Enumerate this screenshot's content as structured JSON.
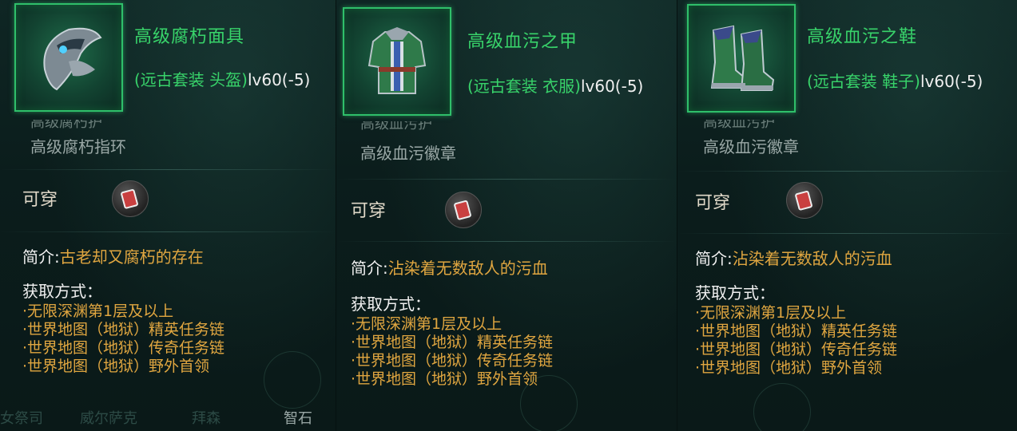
{
  "panels": [
    {
      "item_name": "高级腐朽面具",
      "set_text": "(远古套装 头盔)",
      "level_text": "lv60(-5)",
      "faded_text": "高级腐朽护",
      "set_piece": "高级腐朽指环",
      "wearable": "可穿",
      "desc_label": "简介:",
      "desc_value": "古老却又腐朽的存在",
      "acq_title": "获取方式：",
      "acq": [
        "·无限深渊第1层及以上",
        "·世界地图（地狱）精英任务链",
        "·世界地图（地狱）传奇任务链",
        "·世界地图（地狱）野外首领"
      ],
      "bottom": [
        "女祭司",
        "威尔萨克",
        "拜森",
        "智石"
      ]
    },
    {
      "item_name": "高级血污之甲",
      "set_text": "(远古套装 衣服)",
      "level_text": "lv60(-5)",
      "faded_text": "高级血污护",
      "set_piece": "高级血污徽章",
      "wearable": "可穿",
      "desc_label": "简介:",
      "desc_value": "沾染着无数敌人的污血",
      "acq_title": "获取方式：",
      "acq": [
        "·无限深渊第1层及以上",
        "·世界地图（地狱）精英任务链",
        "·世界地图（地狱）传奇任务链",
        "·世界地图（地狱）野外首领"
      ]
    },
    {
      "item_name": "高级血污之鞋",
      "set_text": "(远古套装 鞋子)",
      "level_text": "lv60(-5)",
      "faded_text": "高级血污护",
      "set_piece": "高级血污徽章",
      "wearable": "可穿",
      "desc_label": "简介:",
      "desc_value": "沾染着无数敌人的污血",
      "acq_title": "获取方式：",
      "acq": [
        "·无限深渊第1层及以上",
        "·世界地图（地狱）精英任务链",
        "·世界地图（地狱）传奇任务链",
        "·世界地图（地狱）野外首领"
      ]
    }
  ],
  "colors": {
    "name_green": "#38d36a",
    "acq_gold": "#e0a640",
    "frame_green": "#2fbf6a"
  },
  "icons": [
    "helmet-icon",
    "armor-icon",
    "boots-icon",
    "wear-status-icon"
  ]
}
